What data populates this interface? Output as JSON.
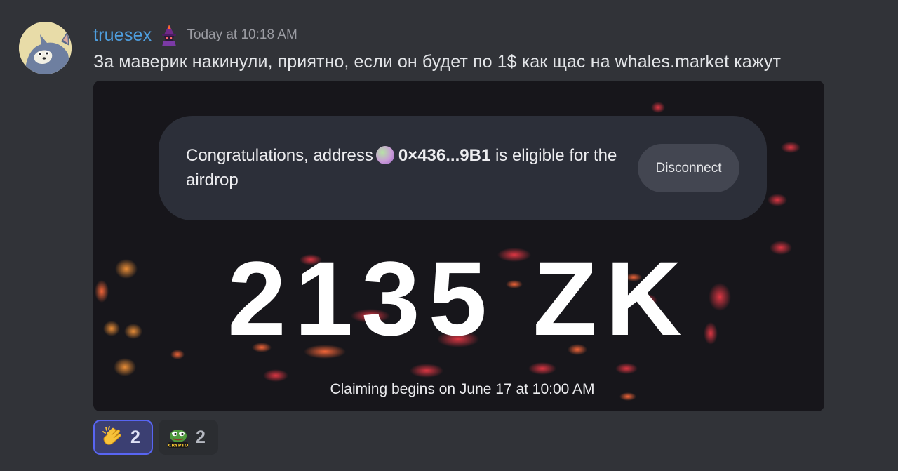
{
  "message": {
    "username": "truesex",
    "timestamp": "Today at 10:18 AM",
    "text": "За маверик накинули, приятно, если он будет по 1$ как щас на whales.market кажут",
    "avatar_icon": "tom-cat-avatar",
    "role_icon": "wizard-icon"
  },
  "attachment": {
    "congrats_prefix": "Congratulations, address",
    "address": "0×436...9B1",
    "congrats_suffix": "is eligible for the airdrop",
    "disconnect_label": "Disconnect",
    "amount": "2135 ZK",
    "claim_note": "Claiming begins on June 17 at 10:00 AM"
  },
  "reactions": [
    {
      "emoji": "clapping-hands-icon",
      "count": "2",
      "active": true
    },
    {
      "emoji": "pepe-crypto-icon",
      "count": "2",
      "active": false
    }
  ],
  "colors": {
    "background": "#313338",
    "username": "#4e9fe0",
    "accent": "#5865f2"
  }
}
